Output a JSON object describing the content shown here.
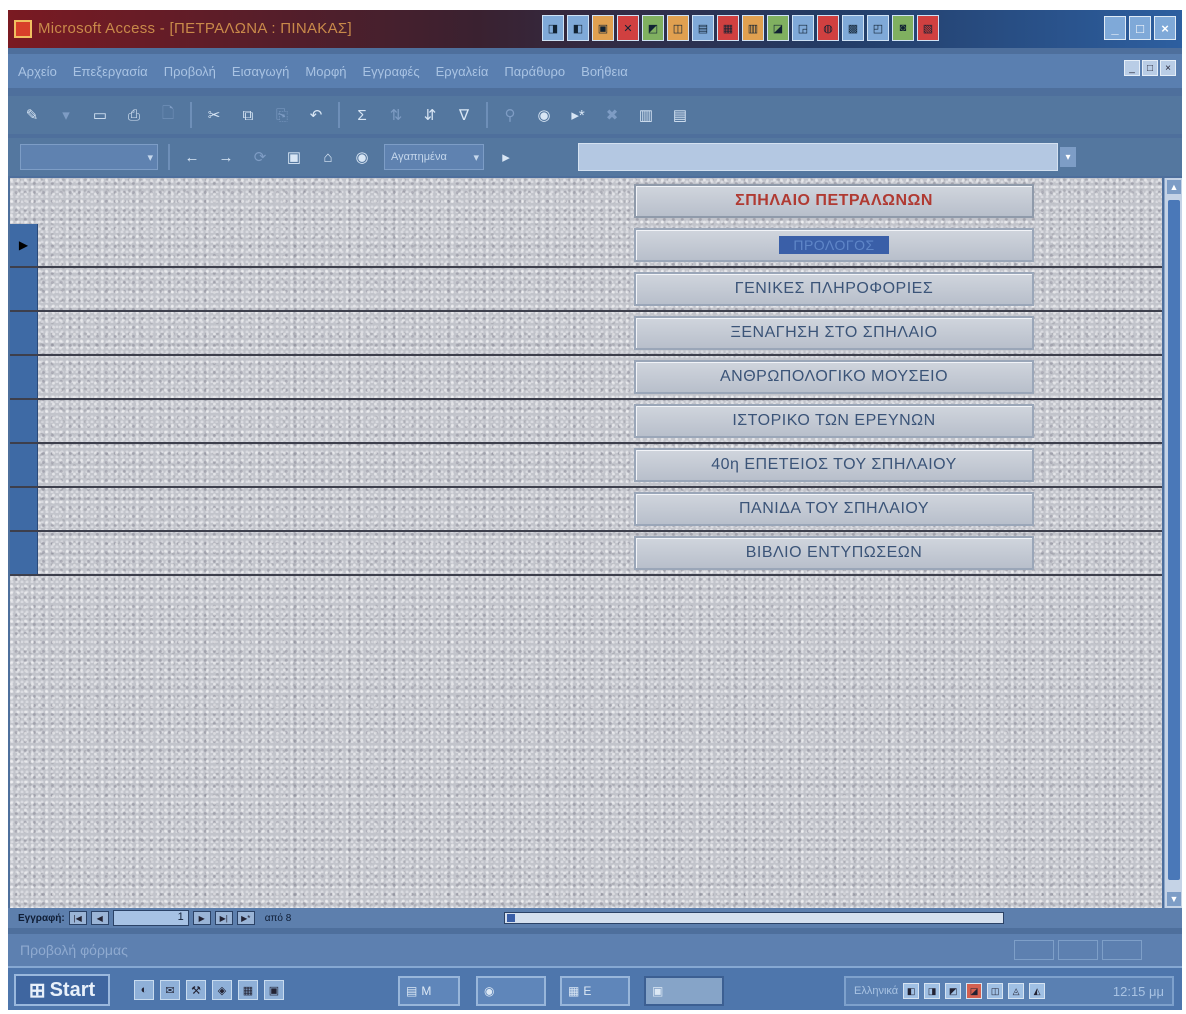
{
  "window": {
    "title": "Microsoft Access - [ΠΕΤΡΑΛΩΝΑ : ΠΙΝΑΚΑΣ]",
    "quick_icons": [
      "◨",
      "◧",
      "▣",
      "✕",
      "◩",
      "◫",
      "▤",
      "▦",
      "▥",
      "◪",
      "◲",
      "◍",
      "▩",
      "◰",
      "◙",
      "▧"
    ],
    "controls": {
      "minimize": "_",
      "maximize": "□",
      "close": "×"
    }
  },
  "menu": {
    "items": [
      "Αρχείο",
      "Επεξεργασία",
      "Προβολή",
      "Εισαγωγή",
      "Μορφή",
      "Εγγραφές",
      "Εργαλεία",
      "Παράθυρο",
      "Βοήθεια"
    ],
    "mdi_controls": [
      "_",
      "□",
      "×"
    ]
  },
  "toolbar1": {
    "icons": [
      "✎",
      "▾",
      "▭",
      "⎙",
      "🗋",
      "✂",
      "⧉",
      "⎘",
      "↶",
      "Σ",
      "⇅",
      "⇵",
      "∇",
      "⚲",
      "◉",
      "▸*",
      "✖",
      "▥",
      "▤"
    ]
  },
  "toolbar2": {
    "combo_left_value": "",
    "nav_icons": [
      "←",
      "→",
      "⟳",
      "▣",
      "⌂",
      "◉"
    ],
    "favorites_label": "Αγαπημένα",
    "go_label": "▸",
    "address_value": ""
  },
  "form": {
    "title_button": "ΣΠΗΛΑΙΟ ΠΕΤΡΑΛΩΝΩΝ",
    "focused_button": "ΠΡΟΛΟΓΟΣ",
    "buttons": [
      "ΓΕΝΙΚΕΣ ΠΛΗΡΟΦΟΡΙΕΣ",
      "ΞΕΝΑΓΗΣΗ ΣΤΟ ΣΠΗΛΑΙΟ",
      "ΑΝΘΡΩΠΟΛΟΓΙΚΟ ΜΟΥΣΕΙΟ",
      "ΙΣΤΟΡΙΚΟ ΤΩΝ ΕΡΕΥΝΩΝ",
      "40η ΕΠΕΤΕΙΟΣ ΤΟΥ ΣΠΗΛΑΙΟΥ",
      "ΠΑΝΙΔΑ ΤΟΥ ΣΠΗΛΑΙΟΥ",
      "ΒΙΒΛΙΟ ΕΝΤΥΠΩΣΕΩΝ"
    ],
    "record_selector_arrow": "▶"
  },
  "navigation": {
    "label": "Εγγραφή:",
    "first": "|◀",
    "prev": "◀",
    "current": "1",
    "next": "▶",
    "last": "▶|",
    "new": "▶*",
    "of_text": "από 8"
  },
  "status": {
    "text": "Προβολή φόρμας"
  },
  "taskbar": {
    "start_label": "Start",
    "quick_launch": [
      "◐",
      "✉",
      "⚒",
      "◈",
      "▦",
      "▣"
    ],
    "tasks": [
      {
        "icon": "▤",
        "label": "M"
      },
      {
        "icon": "◉",
        "label": ""
      },
      {
        "icon": "▦",
        "label": "E"
      },
      {
        "icon": "▣",
        "label": ""
      }
    ],
    "tray_text": "Ελληνικά",
    "tray_icons": [
      "◧",
      "◨",
      "◩",
      "◪",
      "◫",
      "◬",
      "◭"
    ],
    "clock": "12:15 μμ"
  },
  "colors": {
    "title_button_text": "#b03a32",
    "button_text": "#3b5478",
    "record_selector": "#3e6aa5",
    "focus_highlight": "#3a5fa8"
  }
}
